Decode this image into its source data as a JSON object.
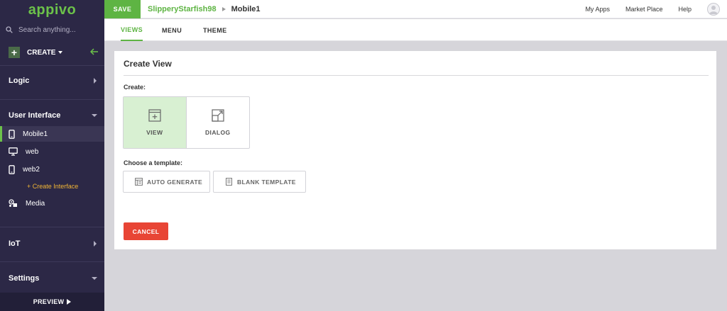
{
  "sidebar": {
    "logo": "appivo",
    "search_placeholder": "Search anything...",
    "create_label": "CREATE",
    "sections": {
      "logic": "Logic",
      "user_interface": "User Interface",
      "iot": "IoT",
      "settings": "Settings"
    },
    "interfaces": [
      {
        "label": "Mobile1",
        "icon": "mobile-icon",
        "active": true
      },
      {
        "label": "web",
        "icon": "desktop-icon",
        "active": false
      },
      {
        "label": "web2",
        "icon": "mobile-icon",
        "active": false
      }
    ],
    "create_interface": "+ Create Interface",
    "media": "Media",
    "preview": "PREVIEW",
    "accent": "#6cc24a",
    "bg": "#2c2846"
  },
  "topbar": {
    "save": "SAVE",
    "app_name": "SlipperyStarfish98",
    "current_view": "Mobile1",
    "links": [
      "My Apps",
      "Market Place",
      "Help"
    ]
  },
  "tabs": [
    "VIEWS",
    "MENU",
    "THEME"
  ],
  "active_tab": "VIEWS",
  "panel": {
    "title": "Create View",
    "create_label": "Create:",
    "choices": [
      {
        "label": "VIEW",
        "icon": "view-icon",
        "selected": true
      },
      {
        "label": "DIALOG",
        "icon": "dialog-icon",
        "selected": false
      }
    ],
    "template_label": "Choose a template:",
    "templates": [
      {
        "label": "AUTO GENERATE",
        "icon": "auto-generate-icon"
      },
      {
        "label": "BLANK TEMPLATE",
        "icon": "blank-template-icon"
      }
    ],
    "cancel": "CANCEL"
  },
  "colors": {
    "green": "#5eb443",
    "red": "#e84535",
    "selected_bg": "#d8f0d2"
  }
}
